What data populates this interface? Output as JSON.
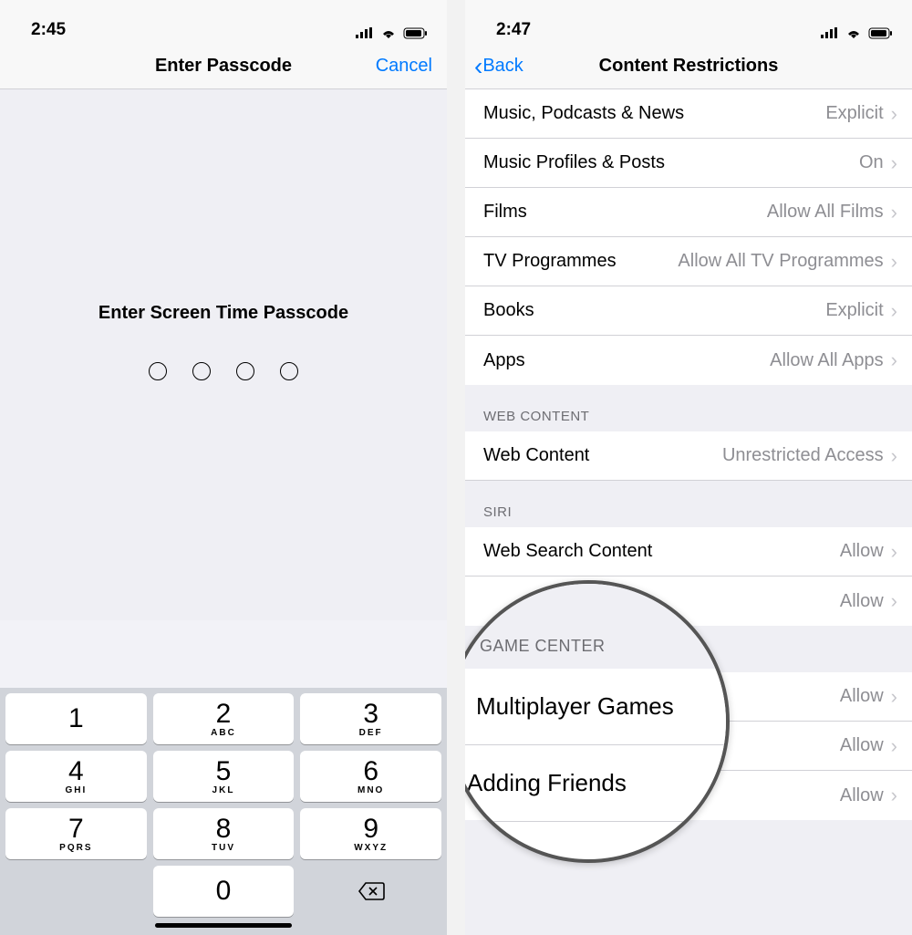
{
  "left": {
    "status": {
      "time": "2:45"
    },
    "nav": {
      "title": "Enter Passcode",
      "cancel": "Cancel"
    },
    "prompt": "Enter Screen Time Passcode",
    "keypad": [
      {
        "n": "1",
        "sub": ""
      },
      {
        "n": "2",
        "sub": "ABC"
      },
      {
        "n": "3",
        "sub": "DEF"
      },
      {
        "n": "4",
        "sub": "GHI"
      },
      {
        "n": "5",
        "sub": "JKL"
      },
      {
        "n": "6",
        "sub": "MNO"
      },
      {
        "n": "7",
        "sub": "PQRS"
      },
      {
        "n": "8",
        "sub": "TUV"
      },
      {
        "n": "9",
        "sub": "WXYZ"
      },
      {
        "n": "",
        "sub": ""
      },
      {
        "n": "0",
        "sub": ""
      },
      {
        "n": "⌫",
        "sub": ""
      }
    ]
  },
  "right": {
    "status": {
      "time": "2:47"
    },
    "nav": {
      "back": "Back",
      "title": "Content Restrictions"
    },
    "rows": [
      {
        "label": "Music, Podcasts & News",
        "value": "Explicit"
      },
      {
        "label": "Music Profiles & Posts",
        "value": "On"
      },
      {
        "label": "Films",
        "value": "Allow All Films"
      },
      {
        "label": "TV Programmes",
        "value": "Allow All TV Programmes"
      },
      {
        "label": "Books",
        "value": "Explicit"
      },
      {
        "label": "Apps",
        "value": "Allow All Apps"
      }
    ],
    "sections": {
      "web": {
        "header": "WEB CONTENT",
        "row": {
          "label": "Web Content",
          "value": "Unrestricted Access"
        }
      },
      "siri": {
        "header": "SIRI",
        "rows": [
          {
            "label": "Web Search Content",
            "value": "Allow"
          },
          {
            "label": "",
            "value": "Allow"
          }
        ]
      },
      "game": {
        "header": "GAME CENTER",
        "rows": [
          {
            "label": "Multiplayer Games",
            "value": "Allow"
          },
          {
            "label": "",
            "value": "Allow"
          },
          {
            "label": "Adding Friends",
            "value": "Allow"
          }
        ]
      }
    },
    "magnifier": {
      "header": "GAME CENTER",
      "rows": [
        {
          "label": "Multiplayer Games"
        },
        {
          "label": "Adding Friends"
        }
      ]
    }
  }
}
